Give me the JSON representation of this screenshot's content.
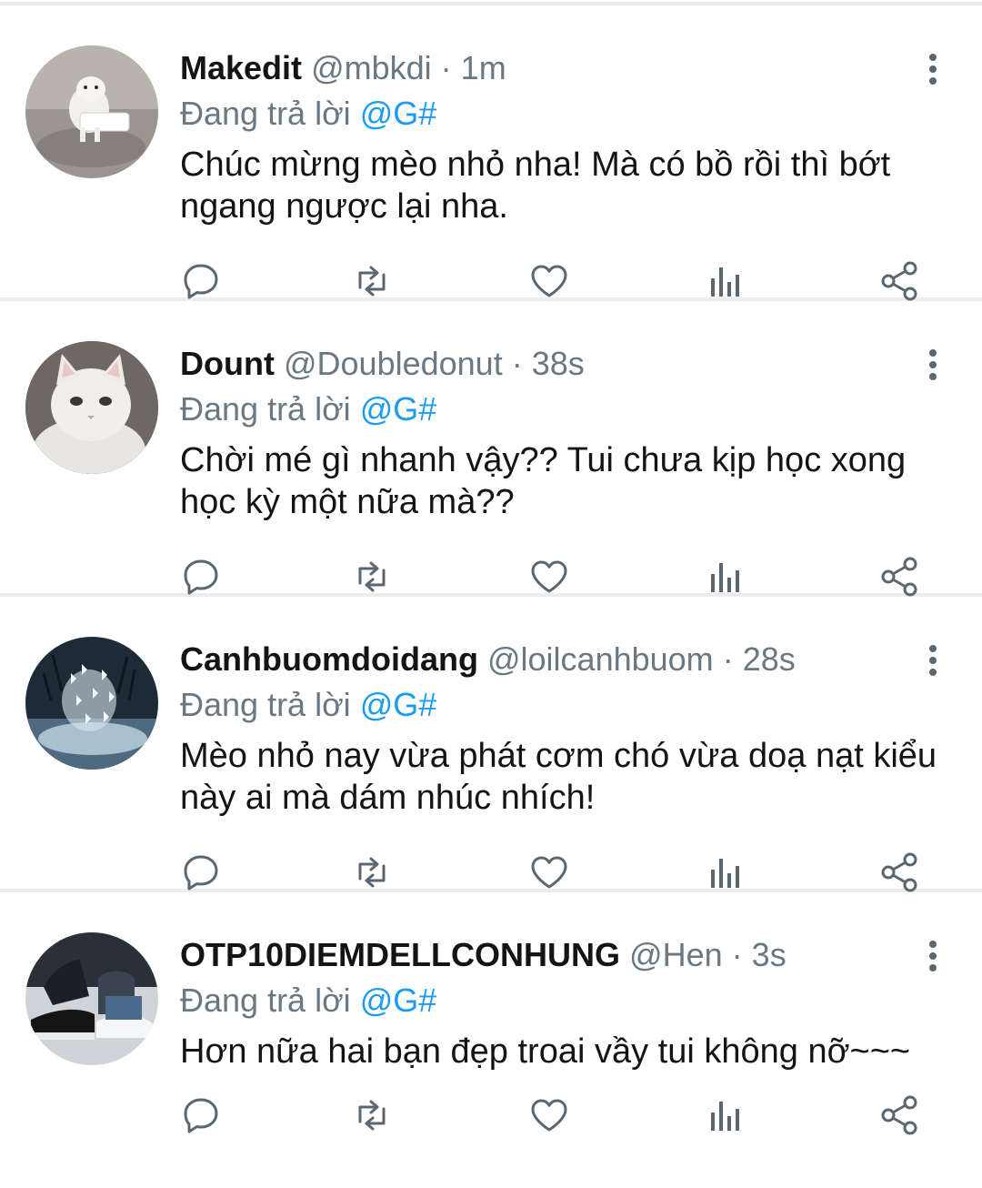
{
  "colors": {
    "accent": "#1d9bf0",
    "secondary_text": "#697882",
    "primary_text": "#141414",
    "divider": "#ececec"
  },
  "replying_to_label": "Đang trả lời",
  "replying_to_handle": "@G#",
  "separator": "·",
  "tweets": [
    {
      "name": "Makedit",
      "handle": "@mbkdi",
      "time": "1m",
      "text": "Chúc mừng mèo nhỏ nha! Mà có bồ rồi thì bớt ngang ngược lại nha.",
      "avatar": "small-white-dog-avatar"
    },
    {
      "name": "Dount",
      "handle": "@Doubledonut",
      "time": "38s",
      "text": "Chời mé gì nhanh vậy?? Tui chưa kịp học xong học kỳ một nữa mà??",
      "avatar": "white-cat-avatar"
    },
    {
      "name": "Canhbuomdoidang",
      "handle": "@loilcanhbuom",
      "time": "28s",
      "text": "Mèo nhỏ nay vừa phát cơm chó vừa doạ nạt kiểu này ai mà dám nhúc nhích!",
      "avatar": "butterflies-avatar"
    },
    {
      "name": "OTP10DIEMDELLCONHUNG",
      "handle": "@Hen",
      "time": "3s",
      "text": "Hơn nữa hai bạn đẹp troai vầy tui không nỡ~~~",
      "avatar": "sneakers-avatar"
    }
  ]
}
